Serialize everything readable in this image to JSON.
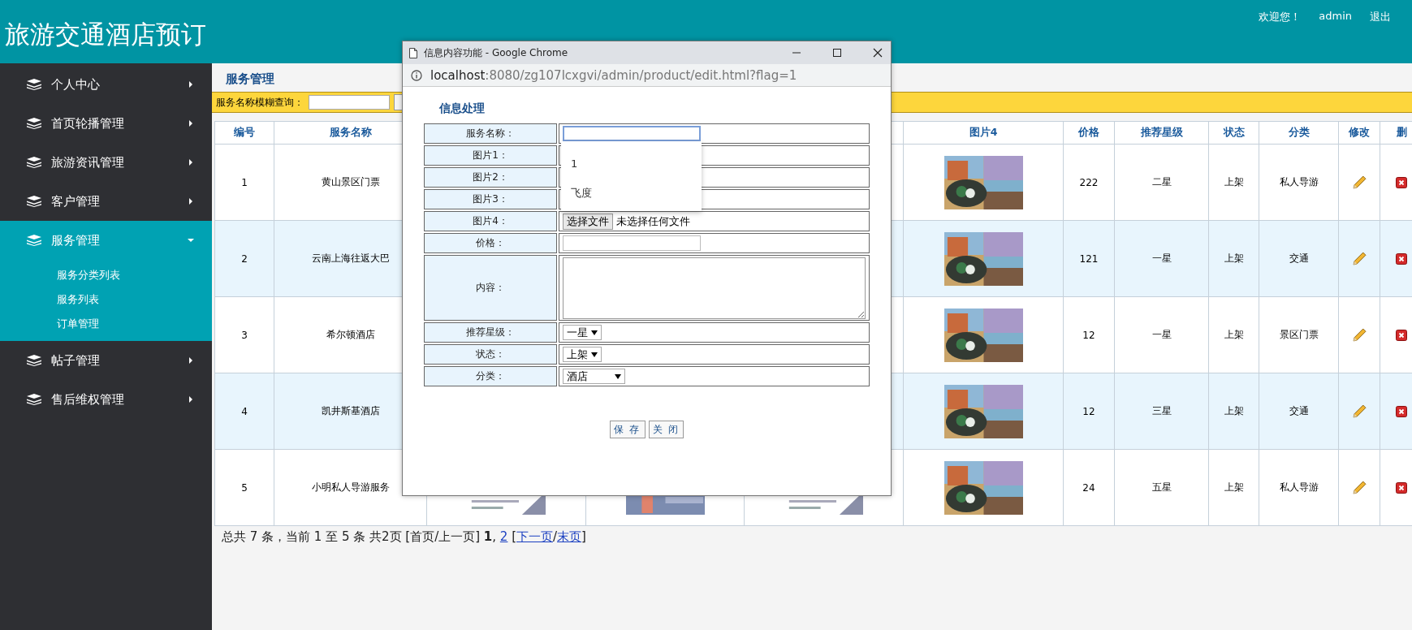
{
  "header": {
    "title": "旅游交通酒店预订",
    "welcome": "欢迎您！",
    "user": "admin",
    "logout": "退出"
  },
  "sidebar": {
    "items": [
      {
        "label": "个人中心",
        "selected": false,
        "expanded": false
      },
      {
        "label": "首页轮播管理",
        "selected": false,
        "expanded": false
      },
      {
        "label": "旅游资讯管理",
        "selected": false,
        "expanded": false
      },
      {
        "label": "客户管理",
        "selected": false,
        "expanded": false
      },
      {
        "label": "服务管理",
        "selected": true,
        "expanded": true,
        "children": [
          {
            "label": "服务分类列表"
          },
          {
            "label": "服务列表"
          },
          {
            "label": "订单管理"
          }
        ]
      },
      {
        "label": "帖子管理",
        "selected": false,
        "expanded": false
      },
      {
        "label": "售后维权管理",
        "selected": false,
        "expanded": false
      }
    ]
  },
  "page": {
    "title": "服务管理",
    "search": {
      "label": "服务名称模糊查询："
    },
    "table": {
      "columns": [
        {
          "label": "编号"
        },
        {
          "label": "服务名称"
        },
        {
          "label": "图片4"
        },
        {
          "label": "价格"
        },
        {
          "label": "推荐星级"
        },
        {
          "label": "状态"
        },
        {
          "label": "分类"
        },
        {
          "label": "修改"
        },
        {
          "label": "删"
        }
      ],
      "rows": [
        {
          "id": "1",
          "name": "黄山景区门票",
          "price": "222",
          "stars_label": "二星",
          "status": "上架",
          "category": "私人导游"
        },
        {
          "id": "2",
          "name": "云南上海往返大巴",
          "price": "121",
          "stars_label": "一星",
          "status": "上架",
          "category": "交通"
        },
        {
          "id": "3",
          "name": "希尔顿酒店",
          "price": "12",
          "stars_label": "一星",
          "status": "上架",
          "category": "景区门票"
        },
        {
          "id": "4",
          "name": "凯井斯基酒店",
          "price": "12",
          "stars_label": "三星",
          "status": "上架",
          "category": "交通"
        },
        {
          "id": "5",
          "name": "小明私人导游服务",
          "price": "24",
          "stars_label": "五星",
          "status": "上架",
          "category": "私人导游"
        }
      ]
    },
    "pagination": [
      {
        "kind": "text",
        "text": "总共 7 条，当前 1 至 5 条 共2页  [首页/上一页] "
      },
      {
        "kind": "bold",
        "text": "1"
      },
      {
        "kind": "text",
        "text": ", "
      },
      {
        "kind": "link",
        "text": "2"
      },
      {
        "kind": "text",
        "text": " ["
      },
      {
        "kind": "link",
        "text": "下一页"
      },
      {
        "kind": "text",
        "text": "/"
      },
      {
        "kind": "link",
        "text": "末页"
      },
      {
        "kind": "text",
        "text": "]"
      }
    ]
  },
  "dialog": {
    "window_title": "信息内容功能 - Google Chrome",
    "url_host": "localhost",
    "url_rest": ":8080/zg107lcxgvi/admin/product/edit.html?flag=1",
    "heading": "信息处理",
    "fields": [
      {
        "label": "服务名称：",
        "kind": "text",
        "focused": true
      },
      {
        "label": "图片1：",
        "kind": "covered"
      },
      {
        "label": "图片2：",
        "kind": "covered"
      },
      {
        "label": "图片3：",
        "kind": "covered"
      },
      {
        "label": "图片4：",
        "kind": "file",
        "button": "选择文件",
        "status": "未选择任何文件"
      },
      {
        "label": "价格：",
        "kind": "text",
        "focused": false
      },
      {
        "label": "内容：",
        "kind": "textarea"
      },
      {
        "label": "推荐星级：",
        "kind": "select",
        "value": "一星",
        "wide": false
      },
      {
        "label": "状态：",
        "kind": "select",
        "value": "上架",
        "wide": false
      },
      {
        "label": "分类：",
        "kind": "select",
        "value": "酒店",
        "wide": true
      }
    ],
    "suggestions": [
      "1",
      "飞度"
    ],
    "buttons": [
      "保 存",
      "关 闭"
    ]
  }
}
